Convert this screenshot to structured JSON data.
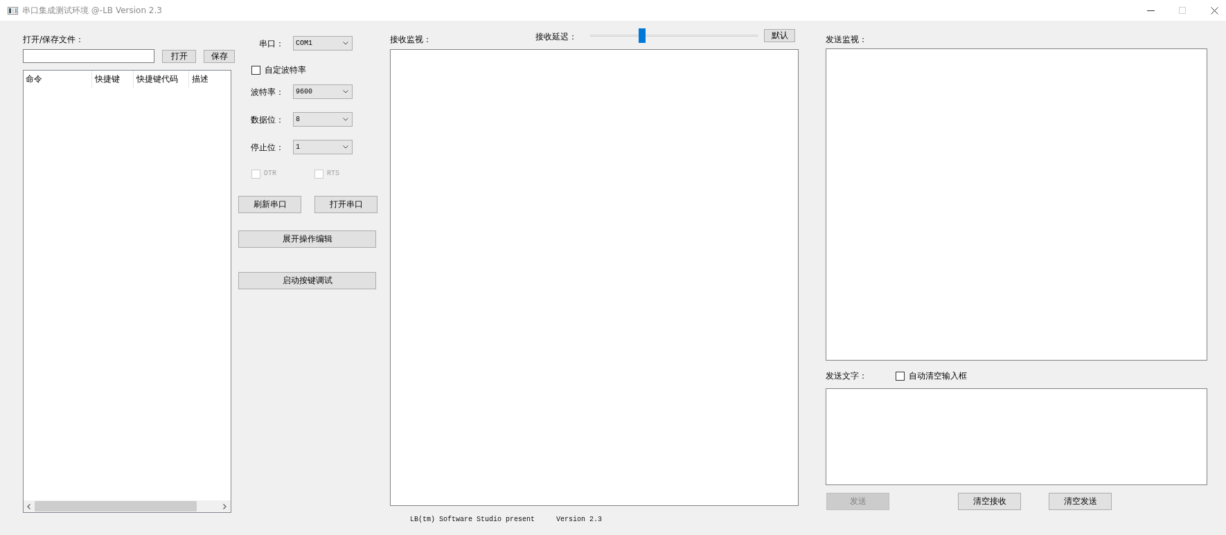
{
  "window": {
    "title": "串口集成测试环境 @-LB Version 2.3",
    "controls": [
      {
        "kind": "minimize",
        "disabled": false
      },
      {
        "kind": "maximize",
        "disabled": true
      },
      {
        "kind": "close",
        "disabled": false
      }
    ]
  },
  "file_panel": {
    "label": "打开/保存文件：",
    "buttons": [
      "打开",
      "保存"
    ],
    "command_table": {
      "columns": [
        "命令",
        "快捷键",
        "快捷键代码",
        "描述"
      ]
    }
  },
  "serial_panel": {
    "settings": [
      {
        "kind": "combo",
        "label": "串口：",
        "value": "COM1"
      },
      {
        "kind": "checkbox",
        "label": "自定波特率",
        "checked": false
      },
      {
        "kind": "combo",
        "label": "波特率：",
        "value": "9600"
      },
      {
        "kind": "combo",
        "label": "数据位：",
        "value": "8"
      },
      {
        "kind": "combo",
        "label": "停止位：",
        "value": "1"
      }
    ],
    "lines": [
      {
        "label": "DTR",
        "checked": false,
        "disabled": true
      },
      {
        "label": "RTS",
        "checked": false,
        "disabled": true
      }
    ],
    "port_buttons": [
      "刷新串口",
      "打开串口"
    ],
    "wide_buttons": [
      "展开操作编辑",
      "启动按键调试"
    ]
  },
  "receive_panel": {
    "label": "接收监视：",
    "delay": {
      "label": "接收延迟：",
      "level": 0.3
    },
    "default_button": "默认",
    "footer": {
      "credit": "LB(tm) Software Studio present",
      "version": "Version 2.3"
    }
  },
  "send_panel": {
    "monitor_label": "发送监视：",
    "text_label": "发送文字：",
    "auto_clear": {
      "label": "自动清空输入框",
      "checked": false
    },
    "buttons": [
      {
        "label": "发送",
        "disabled": true
      },
      {
        "label": "清空接收",
        "disabled": false
      },
      {
        "label": "清空发送",
        "disabled": false
      }
    ]
  }
}
